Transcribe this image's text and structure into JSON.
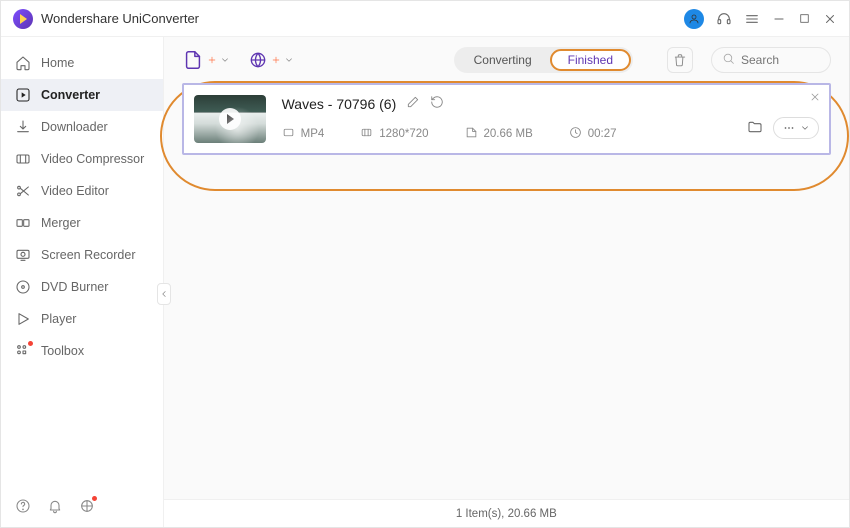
{
  "app": {
    "title": "Wondershare UniConverter"
  },
  "sidebar": {
    "items": [
      {
        "label": "Home"
      },
      {
        "label": "Converter"
      },
      {
        "label": "Downloader"
      },
      {
        "label": "Video Compressor"
      },
      {
        "label": "Video Editor"
      },
      {
        "label": "Merger"
      },
      {
        "label": "Screen Recorder"
      },
      {
        "label": "DVD Burner"
      },
      {
        "label": "Player"
      },
      {
        "label": "Toolbox"
      }
    ]
  },
  "tabs": {
    "converting": "Converting",
    "finished": "Finished"
  },
  "search": {
    "placeholder": "Search"
  },
  "file": {
    "name": "Waves - 70796 (6)",
    "format": "MP4",
    "resolution": "1280*720",
    "size": "20.66 MB",
    "duration": "00:27"
  },
  "status": {
    "text": "1 Item(s), 20.66 MB"
  }
}
